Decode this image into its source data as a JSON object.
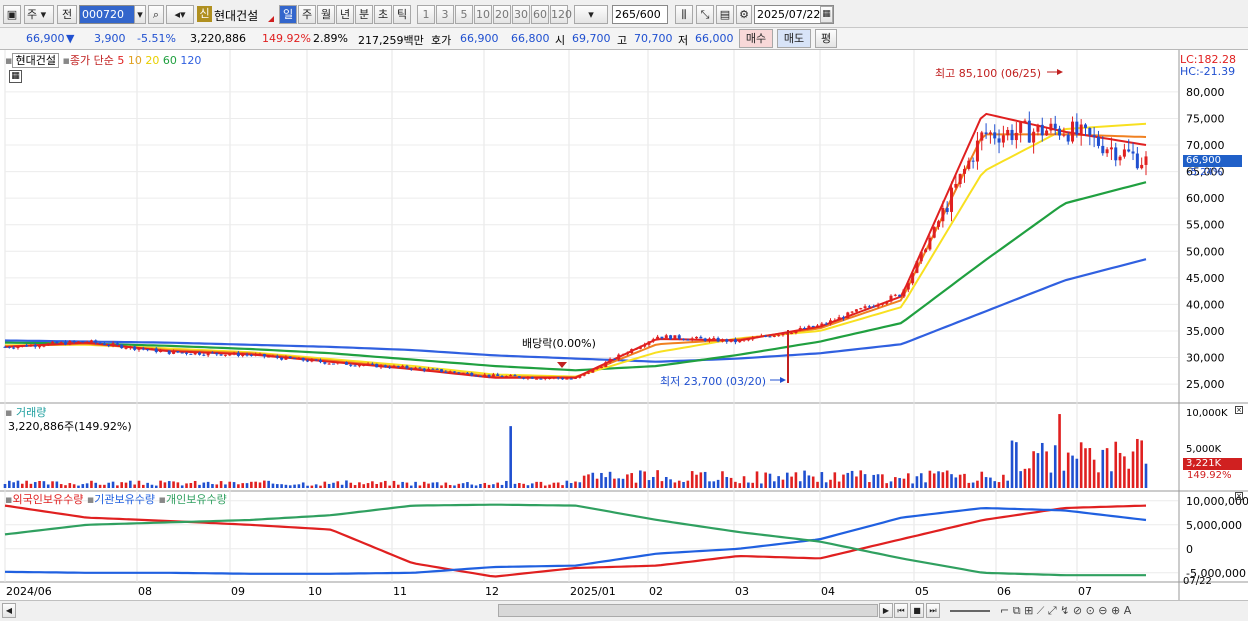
{
  "toolbar": {
    "period_select": "주",
    "mode_select": "전",
    "code": "000720",
    "new_badge": "신",
    "stock_name": "현대건설",
    "periods": [
      "일",
      "주",
      "월",
      "년",
      "분",
      "초",
      "틱"
    ],
    "interval_values": [
      "1",
      "3",
      "5",
      "10",
      "20",
      "30",
      "60",
      "120"
    ],
    "count_value": "265",
    "count_max": "/600",
    "date": "2025/07/22"
  },
  "quote": {
    "price": "66,900",
    "down_arrow": "▼",
    "change": "3,900",
    "change_pct": "-5.51%",
    "volume": "3,220,886",
    "volume_ratio": "149.92%",
    "turnover": "2.89%",
    "amount": "217,259백만",
    "ask_label": "호가",
    "ask": "66,900",
    "bid": "66,800",
    "open_label": "시",
    "open": "69,700",
    "high_label": "고",
    "high": "70,700",
    "low_label": "저",
    "low": "66,000",
    "buy_label": "매수",
    "sell_label": "매도",
    "eval_label": "평"
  },
  "price_panel": {
    "name_tag": "현대건설",
    "indicator_label": "종가 단순",
    "ma_periods": [
      "5",
      "10",
      "20",
      "60",
      "120"
    ],
    "lc": "LC:182.28",
    "hc": "HC:-21.39",
    "y_ticks": [
      "80,000",
      "75,000",
      "70,000",
      "65,000",
      "60,000",
      "55,000",
      "50,000",
      "45,000",
      "40,000",
      "35,000",
      "30,000",
      "25,000"
    ],
    "current_price": "66,900",
    "current_pct": "-5.24%",
    "high_note": "최고 85,100 (06/25)",
    "low_note": "최저 23,700 (03/20)",
    "dividend_note": "배당락(0.00%)"
  },
  "volume_panel": {
    "title": "거래량",
    "readout": "3,220,886주(149.92%)",
    "y_ticks": [
      "10,000K",
      "5,000K"
    ],
    "current": "3,221K",
    "current_pct": "149.92%"
  },
  "holder_panel": {
    "legend": [
      "외국인보유수량",
      "기관보유수량",
      "개인보유수량"
    ],
    "y_ticks": [
      "10,000,000",
      "5,000,000",
      "0",
      "-5,000,000"
    ]
  },
  "x_axis": {
    "labels": [
      "2024/06",
      "08",
      "09",
      "10",
      "11",
      "12",
      "2025/01",
      "02",
      "03",
      "04",
      "05",
      "06",
      "07"
    ],
    "end_label": "07/22"
  },
  "colors": {
    "up": "#e02020",
    "down": "#2050d0",
    "ma5": "#e02020",
    "ma10": "#f08020",
    "ma20": "#f8e020",
    "ma60": "#20a040",
    "ma120": "#3060e0",
    "foreign": "#e02020",
    "institution": "#2060e0",
    "individual": "#30a060"
  },
  "chart_data": {
    "type": "line",
    "x_range": [
      "2024/06",
      "2025/07/22"
    ],
    "y_range": [
      22000,
      86000
    ],
    "close_series": {
      "name": "종가",
      "x": [
        "2024/06",
        "2024/07",
        "2024/08",
        "2024/09",
        "2024/10",
        "2024/11",
        "2024/12",
        "2025/01",
        "2025/02",
        "2025/03",
        "2025/04",
        "2025/05",
        "2025/06",
        "2025/07",
        "2025/07/22"
      ],
      "values": [
        32000,
        33000,
        31000,
        30500,
        29000,
        28000,
        26500,
        26000,
        34000,
        33000,
        36000,
        42000,
        72000,
        73000,
        66900
      ]
    },
    "ma_series": [
      {
        "name": "5",
        "values": [
          32000,
          32800,
          31200,
          30600,
          29200,
          27800,
          26200,
          26200,
          33500,
          33200,
          35800,
          41500,
          76000,
          72500,
          70000
        ]
      },
      {
        "name": "10",
        "values": [
          32100,
          32600,
          31400,
          30800,
          29400,
          28000,
          26400,
          26300,
          32500,
          33400,
          35500,
          40800,
          72000,
          72000,
          71500
        ]
      },
      {
        "name": "20",
        "values": [
          32300,
          32400,
          31700,
          31000,
          29700,
          28400,
          26800,
          26400,
          31000,
          33600,
          35000,
          39500,
          65000,
          73000,
          74000
        ]
      },
      {
        "name": "60",
        "values": [
          32800,
          32600,
          32200,
          31600,
          30800,
          29600,
          28400,
          27600,
          28400,
          30500,
          33000,
          36500,
          48000,
          59000,
          63000
        ]
      },
      {
        "name": "120",
        "values": [
          33200,
          33000,
          32800,
          32400,
          32000,
          31400,
          30400,
          29800,
          29200,
          29800,
          30800,
          32500,
          38500,
          44500,
          48500
        ]
      }
    ],
    "volume": {
      "name": "거래량",
      "unit": "K",
      "current": 3221
    },
    "holdings": {
      "series": [
        {
          "name": "외국인보유수량",
          "values": [
            9000000,
            6500000,
            5800000,
            5000000,
            4000000,
            -3000000,
            -5800000,
            -4000000,
            -3500000,
            -1500000,
            -2000000,
            2000000,
            6000000,
            8500000,
            9000000
          ]
        },
        {
          "name": "기관보유수량",
          "values": [
            -4800000,
            -5000000,
            -5000000,
            -5200000,
            -5200000,
            -5000000,
            -3800000,
            -3500000,
            -1000000,
            0,
            2000000,
            6500000,
            8500000,
            8000000,
            6000000
          ]
        },
        {
          "name": "개인보유수량",
          "values": [
            3000000,
            5000000,
            5500000,
            6000000,
            7000000,
            9000000,
            9200000,
            9000000,
            6000000,
            3500000,
            1500000,
            -2000000,
            -5000000,
            -5500000,
            -5500000
          ]
        }
      ]
    }
  }
}
